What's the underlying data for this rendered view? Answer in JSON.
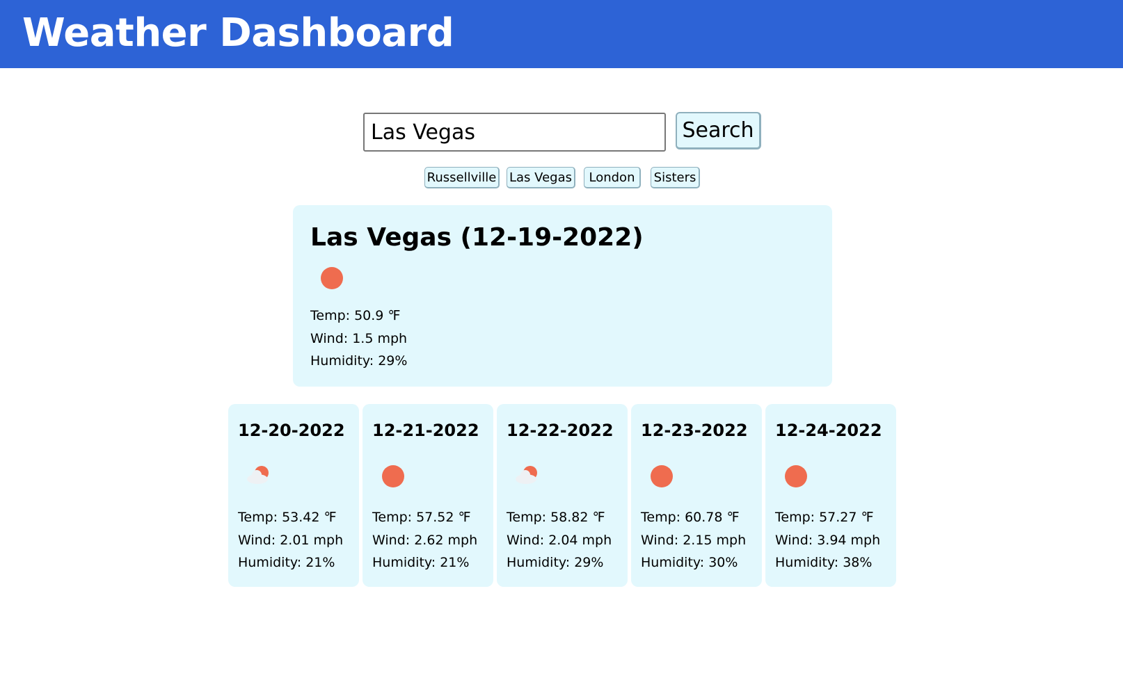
{
  "header": {
    "title": "Weather Dashboard"
  },
  "search": {
    "value": "Las Vegas",
    "button_label": "Search"
  },
  "history": [
    "Russellville",
    "Las Vegas",
    "London",
    "Sisters"
  ],
  "current": {
    "title": "Las Vegas (12-19-2022)",
    "icon": "sun-icon",
    "temp": "Temp: 50.9 ℉",
    "wind": "Wind: 1.5 mph",
    "humidity": "Humidity: 29%"
  },
  "forecast": [
    {
      "date": "12-20-2022",
      "icon": "partly-cloudy-icon",
      "temp": "Temp: 53.42 ℉",
      "wind": "Wind: 2.01 mph",
      "humidity": "Humidity: 21%"
    },
    {
      "date": "12-21-2022",
      "icon": "sun-icon",
      "temp": "Temp: 57.52 ℉",
      "wind": "Wind: 2.62 mph",
      "humidity": "Humidity: 21%"
    },
    {
      "date": "12-22-2022",
      "icon": "partly-cloudy-icon",
      "temp": "Temp: 58.82 ℉",
      "wind": "Wind: 2.04 mph",
      "humidity": "Humidity: 29%"
    },
    {
      "date": "12-23-2022",
      "icon": "sun-icon",
      "temp": "Temp: 60.78 ℉",
      "wind": "Wind: 2.15 mph",
      "humidity": "Humidity: 30%"
    },
    {
      "date": "12-24-2022",
      "icon": "sun-icon",
      "temp": "Temp: 57.27 ℉",
      "wind": "Wind: 3.94 mph",
      "humidity": "Humidity: 38%"
    }
  ],
  "colors": {
    "header": "#2d63d6",
    "card": "#e2f8fd",
    "sun": "#ef6c4f",
    "cloud": "#eef1f4"
  }
}
